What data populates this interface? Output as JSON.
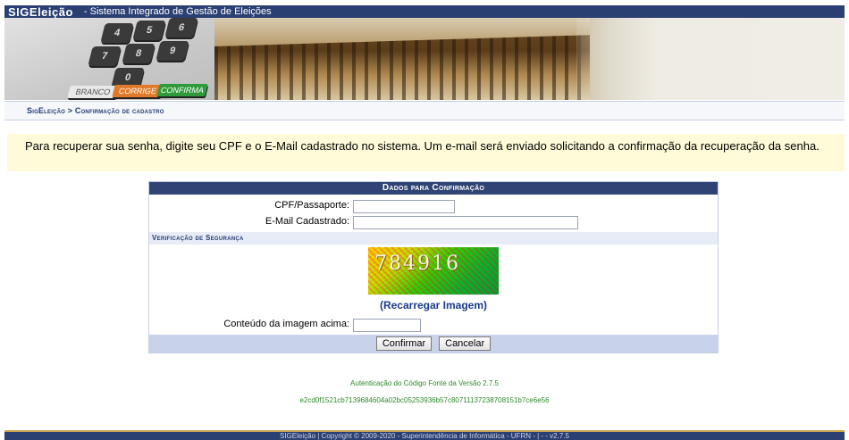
{
  "header": {
    "brand": "SIGEleição",
    "subtitle": "- Sistema Integrado de Gestão de Eleições"
  },
  "banner": {
    "keys": [
      "4",
      "5",
      "6",
      "7",
      "8",
      "9",
      "0"
    ],
    "colored_keys": [
      "BRANCO",
      "CORRIGE",
      "CONFIRMA"
    ]
  },
  "breadcrumb": {
    "text": "SigEleição > Confirmação de cadastro"
  },
  "info_message": "Para recuperar sua senha, digite seu CPF e o E-Mail cadastrado no sistema. Um e-mail será enviado solicitando a confirmação da recuperação da senha.",
  "form": {
    "caption": "Dados para Confirmação",
    "cpf_label": "CPF/Passaporte:",
    "cpf_value": "",
    "email_label": "E-Mail Cadastrado:",
    "email_value": "",
    "security_header": "Verificação de Segurança",
    "captcha_code": "784916",
    "reload_label": "(Recarregar Imagem)",
    "captcha_label": "Conteúdo da imagem acima:",
    "captcha_value": "",
    "confirm_label": "Confirmar",
    "cancel_label": "Cancelar"
  },
  "auth": {
    "title": "Autenticação do Código Fonte da Versão 2.7.5",
    "hash": "e2cd0f1521cb7139684604a02bc05253936b57c80711137238708151b7ce6e56"
  },
  "footer": {
    "text": "SIGEleição | Copyright © 2009-2020 - Superintendência de Informática - UFRN - | - - v2.7.5"
  }
}
